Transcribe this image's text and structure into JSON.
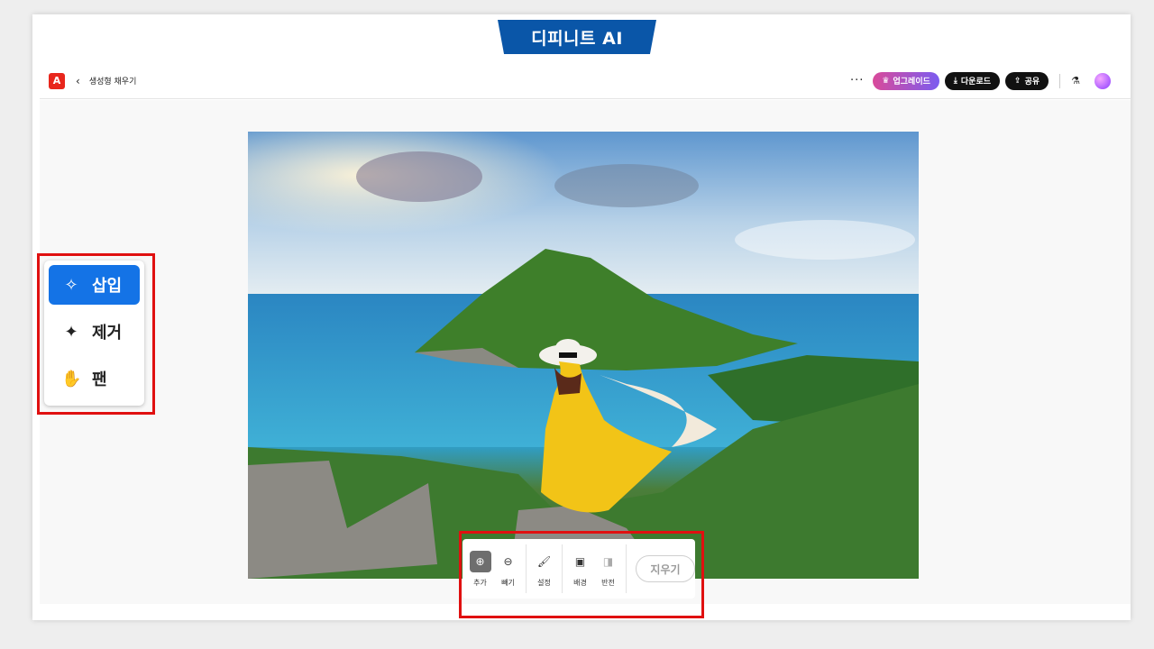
{
  "banner": {
    "text": "디피니트 AI"
  },
  "topbar": {
    "logo": "A",
    "back_glyph": "‹",
    "title": "생성형 채우기",
    "more_glyph": "···",
    "upgrade_label": "업그레이드",
    "download_label": "다운로드",
    "share_label": "공유"
  },
  "left_tools": [
    {
      "label": "삽입",
      "icon": "sparkle-circle-icon",
      "active": true
    },
    {
      "label": "제거",
      "icon": "bandage-sparkle-icon",
      "active": false
    },
    {
      "label": "팬",
      "icon": "hand-icon",
      "active": false
    }
  ],
  "bottom_toolbar": {
    "add_label": "추가",
    "subtract_label": "빼기",
    "settings_label": "설정",
    "background_label": "배경",
    "invert_label": "반전",
    "erase_label": "지우기"
  },
  "colors": {
    "accent": "#1473e6",
    "banner": "#0a56a8",
    "highlight": "#e01010"
  }
}
